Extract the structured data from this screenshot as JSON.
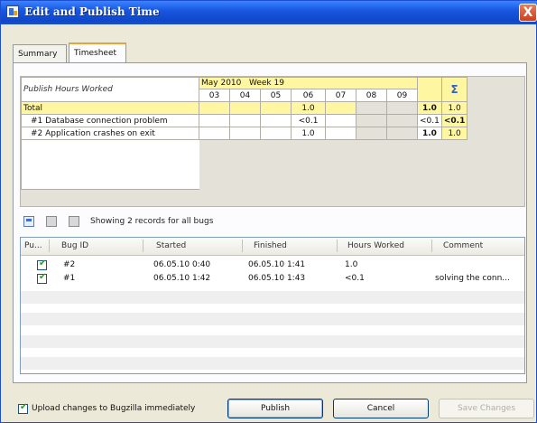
{
  "window": {
    "title": "Edit and Publish Time",
    "close_label": "X"
  },
  "tabs": [
    {
      "label": "Summary",
      "active": false
    },
    {
      "label": "Timesheet",
      "active": true
    }
  ],
  "timesheet": {
    "header_label": "Publish Hours Worked",
    "month_label": "May 2010",
    "week_label": "Week 19",
    "days": [
      "03",
      "04",
      "05",
      "06",
      "07",
      "08",
      "09"
    ],
    "sum_icon": "Σ",
    "rows": [
      {
        "label": "Total",
        "cells": [
          "",
          "",
          "",
          "1.0",
          "",
          "",
          ""
        ],
        "total1": "1.0",
        "total2": "1.0"
      },
      {
        "label": "#1 Database connection problem",
        "cells": [
          "",
          "",
          "",
          "<0.1",
          "",
          "",
          ""
        ],
        "total1": "<0.1",
        "total2": "<0.1"
      },
      {
        "label": "#2 Application crashes on exit",
        "cells": [
          "",
          "",
          "",
          "1.0",
          "",
          "",
          ""
        ],
        "total1": "1.0",
        "total2": "1.0"
      }
    ]
  },
  "toolbar": {
    "status_text": "Showing 2 records for all bugs"
  },
  "list": {
    "columns": [
      "Pu...",
      "Bug ID",
      "Started",
      "Finished",
      "Hours Worked",
      "Comment"
    ],
    "rows": [
      {
        "published": true,
        "bug_id": "#2",
        "started": "06.05.10 0:40",
        "finished": "06.05.10 1:41",
        "hours": "1.0",
        "comment": ""
      },
      {
        "published": true,
        "bug_id": "#1",
        "started": "06.05.10 1:42",
        "finished": "06.05.10 1:43",
        "hours": "<0.1",
        "comment": "solving the conn..."
      }
    ]
  },
  "footer": {
    "upload_label": "Upload changes to Bugzilla immediately",
    "upload_checked": true,
    "publish_label": "Publish",
    "cancel_label": "Cancel",
    "save_label": "Save Changes"
  }
}
